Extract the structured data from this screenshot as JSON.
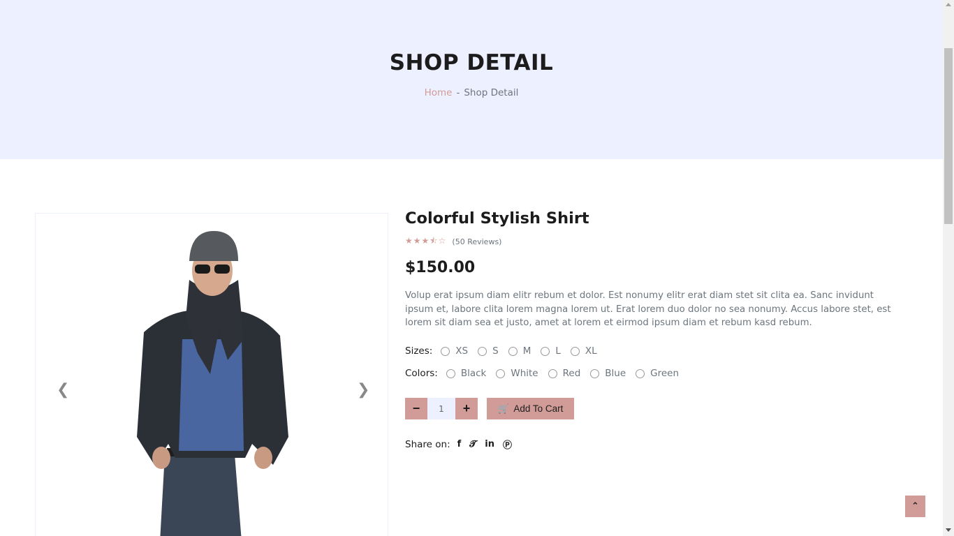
{
  "banner": {
    "title": "SHOP DETAIL",
    "breadcrumb": {
      "home": "Home",
      "separator": "-",
      "current": "Shop Detail"
    }
  },
  "product": {
    "name": "Colorful Stylish Shirt",
    "rating": 3.5,
    "reviews": "(50 Reviews)",
    "price": "$150.00",
    "description": "Volup erat ipsum diam elitr rebum et dolor. Est nonumy elitr erat diam stet sit clita ea. Sanc invidunt ipsum et, labore clita lorem magna lorem ut. Erat lorem duo dolor no sea nonumy. Accus labore stet, est lorem sit diam sea et justo, amet at lorem et eirmod ipsum diam et rebum kasd rebum."
  },
  "sizes": {
    "label": "Sizes:",
    "options": [
      "XS",
      "S",
      "M",
      "L",
      "XL"
    ]
  },
  "colors": {
    "label": "Colors:",
    "options": [
      "Black",
      "White",
      "Red",
      "Blue",
      "Green"
    ]
  },
  "cart": {
    "quantity": "1",
    "add_label": "Add To Cart"
  },
  "share": {
    "label": "Share on:",
    "icons": [
      "facebook-icon",
      "twitter-icon",
      "linkedin-icon",
      "pinterest-icon"
    ]
  },
  "theme": {
    "accent": "#d19c97",
    "banner_bg": "#edf1ff"
  }
}
